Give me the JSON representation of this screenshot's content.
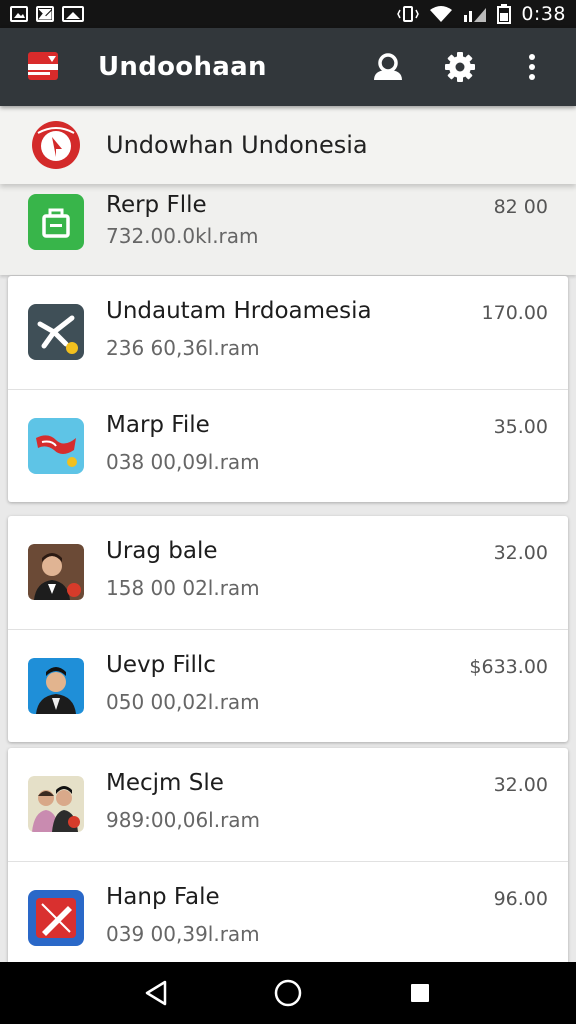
{
  "status_bar": {
    "time": "0:38"
  },
  "app_bar": {
    "title": "Undoohaan"
  },
  "pinned": {
    "title": "Undowhan Undonesia"
  },
  "items": [
    {
      "title": "Rerp Flle",
      "subtitle": "732.00.0kl.ram",
      "amount": "82 00",
      "icon": "lock-file-icon",
      "color": "#38b54a"
    },
    {
      "title": "Undautam Hrdoamesia",
      "subtitle": "236 60,36l.ram",
      "amount": "170.00",
      "icon": "person-running-icon",
      "color": "#3f4f57"
    },
    {
      "title": "Marp File",
      "subtitle": "038 00,09l.ram",
      "amount": "35.00",
      "icon": "flag-icon",
      "color": "#5ec4e6"
    },
    {
      "title": "Urag bale",
      "subtitle": "158 00 02l.ram",
      "amount": "32.00",
      "icon": "man-portrait-icon",
      "color": "#6b4a36"
    },
    {
      "title": "Uevp Fillc",
      "subtitle": "050 00,02l.ram",
      "amount": "$633.00",
      "icon": "man-portrait-icon",
      "color": "#1f8fd8"
    },
    {
      "title": "Mecjm Sle",
      "subtitle": "989:00,06l.ram",
      "amount": "32.00",
      "icon": "couple-portrait-icon",
      "color": "#e5e0c8"
    },
    {
      "title": "Hanp Fale",
      "subtitle": "039 00,39l.ram",
      "amount": "96.00",
      "icon": "edit-pen-icon",
      "color": "#2a68c8"
    }
  ]
}
